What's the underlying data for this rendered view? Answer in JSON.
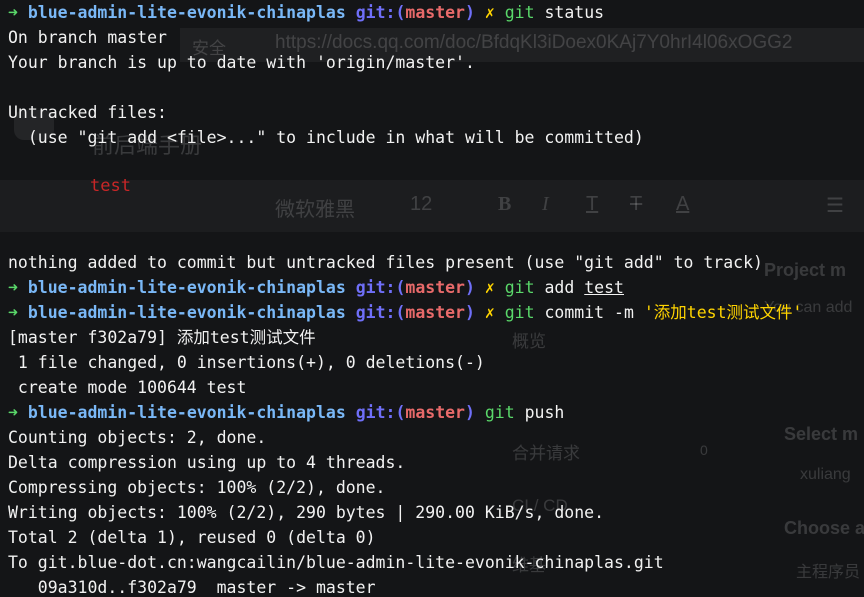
{
  "prompt": {
    "arrow": "➜",
    "dir": "blue-admin-lite-evonik-chinaplas",
    "git_label": "git:",
    "paren_open": "(",
    "branch": "master",
    "paren_close": ")",
    "dirty_marker": "✗"
  },
  "session": {
    "cmd1": {
      "git": "git",
      "args": "status"
    },
    "out1": [
      "On branch master",
      "Your branch is up to date with 'origin/master'.",
      "",
      "Untracked files:",
      "  (use \"git add <file>...\" to include in what will be committed)",
      "",
      "",
      "",
      "",
      "nothing added to commit but untracked files present (use \"git add\" to track)"
    ],
    "cmd2": {
      "git": "git",
      "verb": "add",
      "file": "test"
    },
    "cmd3": {
      "git": "git",
      "verb": "commit -m",
      "message": "'添加test测试文件'"
    },
    "out3": [
      "[master f302a79] 添加test测试文件",
      " 1 file changed, 0 insertions(+), 0 deletions(-)",
      " create mode 100644 test"
    ],
    "cmd4": {
      "git": "git",
      "args": "push"
    },
    "out4": [
      "Counting objects: 2, done.",
      "Delta compression using up to 4 threads.",
      "Compressing objects: 100% (2/2), done.",
      "Writing objects: 100% (2/2), 290 bytes | 290.00 KiB/s, done.",
      "Total 2 (delta 1), reused 0 (delta 0)",
      "To git.blue-dot.cn:wangcailin/blue-admin-lite-evonik-chinaplas.git",
      "   09a310d..f302a79  master -> master"
    ]
  },
  "background": {
    "url": "https://docs.qq.com/doc/BfdqKl3iDoex0KAj7Y0hrI4l06xOGG2",
    "secure_label": "安全",
    "doc_title": "前后端手册",
    "untracked_file": "test",
    "font_name": "微软雅黑",
    "font_size": "12",
    "nav": [
      {
        "label": "概览",
        "count": ""
      },
      {
        "label": "合并请求",
        "count": "0"
      },
      {
        "label": "CI / CD",
        "count": ""
      },
      {
        "label": "维基",
        "count": ""
      }
    ],
    "right_title": "Project m",
    "right_sub": "You can add",
    "select_label": "Select m",
    "select_value": "xuliang",
    "choose_label": "Choose a",
    "choose_value": "主程序员"
  }
}
